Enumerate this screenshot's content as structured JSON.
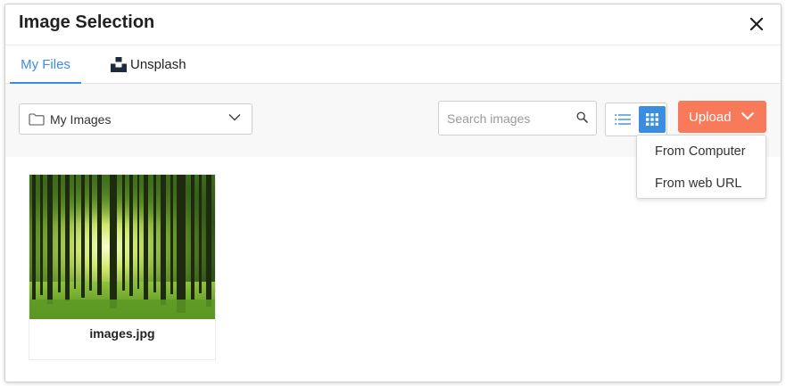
{
  "dialog": {
    "title": "Image Selection",
    "close_icon": "close-icon"
  },
  "tabs": [
    {
      "label": "My Files",
      "active": true
    },
    {
      "label": "Unsplash",
      "active": false,
      "icon": "unsplash-icon"
    }
  ],
  "toolbar": {
    "folder": {
      "selected": "My Images",
      "icon": "folder-icon"
    },
    "search": {
      "placeholder": "Search images",
      "value": "",
      "icon": "search-icon"
    },
    "view_modes": [
      {
        "name": "list",
        "icon": "list-icon",
        "active": false
      },
      {
        "name": "grid",
        "icon": "grid-icon",
        "active": true
      }
    ],
    "upload": {
      "label": "Upload",
      "menu": [
        "From Computer",
        "From web URL"
      ]
    }
  },
  "files": [
    {
      "name": "images.jpg",
      "thumbnail": "forest-image"
    }
  ],
  "colors": {
    "accent": "#3b8de0",
    "upload": "#f97a5a",
    "toolbar_bg": "#f8f8f8"
  }
}
